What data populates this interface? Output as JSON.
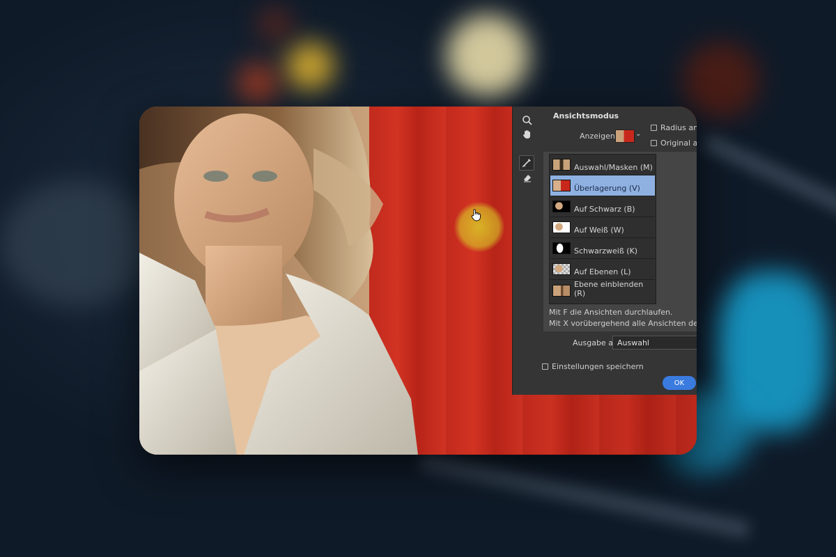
{
  "dialog": {
    "section_title": "Ansichtsmodus",
    "show_label": "Anzeigen:",
    "options": {
      "radius_label": "Radius anze",
      "original_label": "Original anz"
    },
    "view_modes": [
      {
        "label": "Auswahl/Masken (M)",
        "selected": false
      },
      {
        "label": "Überlagerung (V)",
        "selected": true
      },
      {
        "label": "Auf Schwarz (B)",
        "selected": false
      },
      {
        "label": "Auf Weiß (W)",
        "selected": false
      },
      {
        "label": "Schwarzweiß (K)",
        "selected": false
      },
      {
        "label": "Auf Ebenen (L)",
        "selected": false
      },
      {
        "label": "Ebene einblenden (R)",
        "selected": false
      }
    ],
    "hint_1": "Mit F die Ansichten durchlaufen.",
    "hint_2": "Mit X vorübergehend alle Ansichten deaktivieren",
    "output_label": "Ausgabe an:",
    "output_value": "Auswahl",
    "save_settings_label": "Einstellungen speichern",
    "ok_label": "OK"
  },
  "colors": {
    "accent": "#3a7be0",
    "selection": "#8fb1e2",
    "overlay_red": "#c8281c",
    "cursor_highlight": "#dcdc28"
  }
}
